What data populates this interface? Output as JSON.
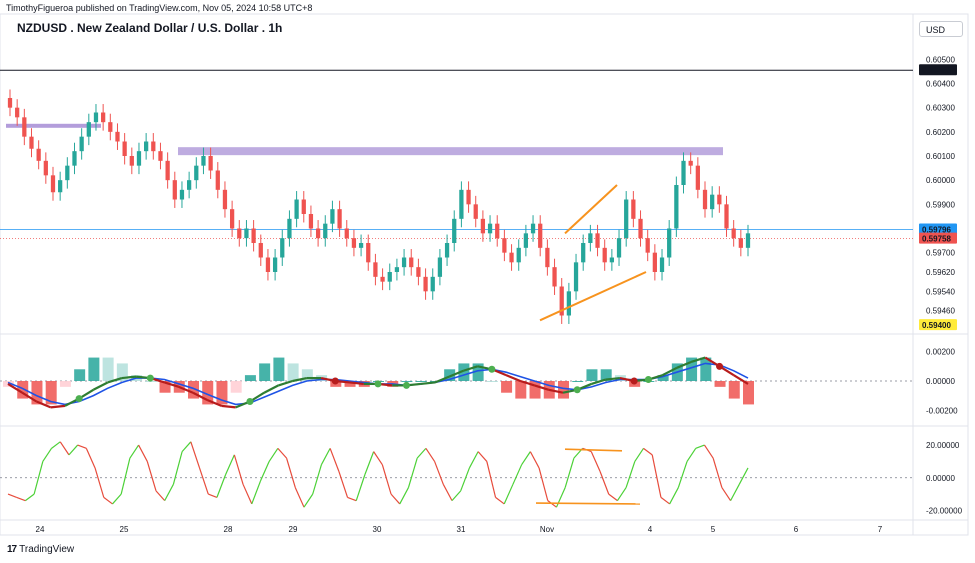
{
  "header": {
    "published": "TimothyFigueroa published on TradingView.com, Nov 05, 2024 10:58 UTC+8",
    "title": "NZDUSD . New Zealand Dollar / U.S. Dollar . 1h",
    "currency_button": "USD"
  },
  "footer": {
    "brand": "TradingView"
  },
  "colors": {
    "up": "#26a69a",
    "down": "#ef5350",
    "zone": "#b39ddb",
    "trendline": "#f7931e",
    "macd": "#1e53e5",
    "signal": "#2e7d32",
    "rsi_up": "#4cd137",
    "rsi_down": "#e74c3c"
  },
  "chart_data": [
    {
      "type": "candlestick",
      "symbol": "NZDUSD",
      "timeframe": "1h",
      "x_labels": [
        "24",
        "25",
        "28",
        "29",
        "30",
        "31",
        "Nov",
        "4",
        "5",
        "6",
        "7"
      ],
      "y_ticks": [
        "0.60500",
        "0.60400",
        "0.60300",
        "0.60200",
        "0.60100",
        "0.60000",
        "0.59900",
        "0.59700",
        "0.59620",
        "0.59540",
        "0.59460"
      ],
      "ylim": [
        0.5938,
        0.6058
      ],
      "price_labels": [
        {
          "value": "0.60455",
          "color": "#131722"
        },
        {
          "value": "0.59796",
          "color": "#2196f3"
        },
        {
          "value": "0.59758",
          "color": "#ef5350"
        },
        {
          "value": "0.59400",
          "color": "#ffeb3b"
        }
      ],
      "closes": [
        0.603,
        0.6026,
        0.6018,
        0.6013,
        0.6008,
        0.6002,
        0.5995,
        0.6,
        0.6006,
        0.6012,
        0.6018,
        0.6024,
        0.6028,
        0.6024,
        0.602,
        0.6016,
        0.601,
        0.6006,
        0.6012,
        0.6016,
        0.6012,
        0.6008,
        0.6,
        0.5992,
        0.5996,
        0.6,
        0.6006,
        0.601,
        0.6004,
        0.5996,
        0.5988,
        0.598,
        0.5976,
        0.598,
        0.5974,
        0.5968,
        0.5962,
        0.5968,
        0.5976,
        0.5984,
        0.5992,
        0.5986,
        0.598,
        0.5976,
        0.5982,
        0.5988,
        0.598,
        0.5976,
        0.5972,
        0.5974,
        0.5966,
        0.596,
        0.5958,
        0.5962,
        0.5964,
        0.5968,
        0.5964,
        0.596,
        0.5954,
        0.596,
        0.5968,
        0.5974,
        0.5984,
        0.5996,
        0.599,
        0.5984,
        0.5978,
        0.5982,
        0.5976,
        0.597,
        0.5966,
        0.5972,
        0.5978,
        0.5982,
        0.5972,
        0.5964,
        0.5956,
        0.5944,
        0.5954,
        0.5966,
        0.5974,
        0.5978,
        0.5972,
        0.5966,
        0.5968,
        0.5976,
        0.5992,
        0.5984,
        0.5976,
        0.597,
        0.5962,
        0.5968,
        0.598,
        0.5998,
        0.6008,
        0.6006,
        0.5996,
        0.5988,
        0.5994,
        0.599,
        0.598,
        0.5976,
        0.5972,
        0.5978
      ],
      "zones": [
        {
          "name": "left-zone",
          "y": 0.60225
        },
        {
          "name": "upper-zone",
          "y": 0.6012
        }
      ],
      "trendlines": [
        {
          "name": "upper-trendline",
          "from": [
            0.5978
          ],
          "to": [
            0.5998
          ]
        },
        {
          "name": "lower-trendline",
          "from": [
            0.5942
          ],
          "to": [
            0.5962
          ]
        }
      ]
    },
    {
      "type": "macd",
      "y_ticks": [
        "0.00200",
        "0.00000",
        "-0.00200"
      ],
      "ylim": [
        -0.0028,
        0.0028
      ],
      "macd": [
        -0.0002,
        -0.0008,
        -0.0014,
        -0.0018,
        -0.0017,
        -0.0012,
        -0.0006,
        -0.0001,
        0.0002,
        0.0003,
        0.0002,
        -0.0001,
        -0.0004,
        -0.0008,
        -0.0013,
        -0.0017,
        -0.0018,
        -0.0014,
        -0.0008,
        -0.0003,
        0.0,
        0.0002,
        0.0002,
        0.0,
        -0.0001,
        -0.0002,
        -0.0002,
        -0.0003,
        -0.0003,
        -0.0002,
        -0.0001,
        0.0003,
        0.0007,
        0.001,
        0.0008,
        0.0004,
        0.0,
        -0.0003,
        -0.0006,
        -0.0008,
        -0.0006,
        -0.0002,
        0.0001,
        0.0002,
        0.0,
        0.0001,
        0.0004,
        0.0009,
        0.0013,
        0.0016,
        0.001,
        0.0004,
        -0.0002
      ],
      "signal": [
        -0.0001,
        -0.0005,
        -0.001,
        -0.0014,
        -0.0016,
        -0.0014,
        -0.001,
        -0.0005,
        -0.0001,
        0.0002,
        0.0002,
        0.0001,
        -0.0002,
        -0.0005,
        -0.0009,
        -0.0013,
        -0.0016,
        -0.0015,
        -0.0011,
        -0.0007,
        -0.0003,
        0.0,
        0.0001,
        0.0001,
        0.0,
        -0.0001,
        -0.0002,
        -0.0002,
        -0.0003,
        -0.0002,
        -0.0001,
        0.0001,
        0.0004,
        0.0007,
        0.0008,
        0.0006,
        0.0003,
        0.0,
        -0.0003,
        -0.0005,
        -0.0006,
        -0.0004,
        -0.0001,
        0.0001,
        0.0001,
        0.0001,
        0.0003,
        0.0006,
        0.0009,
        0.0012,
        0.0011,
        0.0007,
        0.0002
      ]
    },
    {
      "type": "line",
      "name": "oscillator",
      "y_ticks": [
        "20.00000",
        "0.00000",
        "-20.00000"
      ],
      "ylim": [
        -24,
        28
      ],
      "values": [
        -10,
        -12,
        -14,
        -10,
        10,
        18,
        22,
        14,
        20,
        18,
        6,
        -12,
        -16,
        -10,
        12,
        20,
        10,
        -8,
        -14,
        -4,
        16,
        22,
        6,
        -10,
        -12,
        2,
        14,
        -4,
        -16,
        -2,
        10,
        18,
        12,
        -6,
        -18,
        -10,
        8,
        18,
        4,
        -12,
        -14,
        2,
        16,
        8,
        -10,
        -16,
        -6,
        12,
        18,
        10,
        -4,
        -14,
        -8,
        6,
        16,
        10,
        -12,
        -16,
        -4,
        8,
        16,
        6,
        -14,
        -18,
        -6,
        12,
        18,
        16,
        4,
        -10,
        -14,
        -6,
        10,
        18,
        14,
        -12,
        -16,
        -6,
        10,
        18,
        20,
        12,
        -6,
        -14,
        -4,
        6
      ],
      "annotations": [
        {
          "name": "upper-divergence",
          "from": 17.5,
          "to": 16.5
        },
        {
          "name": "lower-divergence",
          "from": -15.5,
          "to": -16
        }
      ]
    }
  ]
}
